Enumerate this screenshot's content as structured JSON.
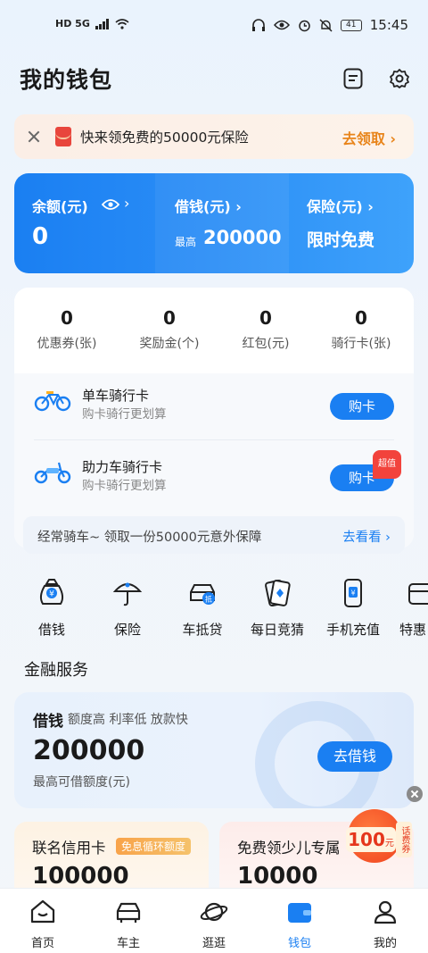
{
  "status_bar": {
    "left_indicators": "HD 5G",
    "battery": "41",
    "time": "15:45"
  },
  "header": {
    "title": "我的钱包",
    "icons": [
      "bill-icon",
      "gear-icon"
    ]
  },
  "promo": {
    "text": "快来领免费的50000元保险",
    "link": "去领取 ›"
  },
  "balance_card": {
    "balance_label": "余额(元)",
    "balance_value": "0",
    "borrow_label": "借钱(元) ›",
    "borrow_prefix": "最高",
    "borrow_value": "200000",
    "insurance_label": "保险(元) ›",
    "insurance_value": "限时免费",
    "accent": "#1a7ff2"
  },
  "stats": [
    {
      "value": "0",
      "label": "优惠券(张)"
    },
    {
      "value": "0",
      "label": "奖励金(个)"
    },
    {
      "value": "0",
      "label": "红包(元)"
    },
    {
      "value": "0",
      "label": "骑行卡(张)"
    }
  ],
  "ride_cards": [
    {
      "title": "单车骑行卡",
      "subtitle": "购卡骑行更划算",
      "button": "购卡",
      "icon": "bicycle-icon"
    },
    {
      "title": "助力车骑行卡",
      "subtitle": "购卡骑行更划算",
      "button": "购卡",
      "badge": "超值",
      "icon": "ebike-icon"
    }
  ],
  "ride_tip": {
    "text": "经常骑车~ 领取一份50000元意外保障",
    "link": "去看看 ›"
  },
  "shortcuts": [
    {
      "label": "借钱",
      "icon": "money-bag-icon"
    },
    {
      "label": "保险",
      "icon": "umbrella-icon"
    },
    {
      "label": "车抵贷",
      "icon": "car-loan-icon"
    },
    {
      "label": "每日竞猜",
      "icon": "cards-icon"
    },
    {
      "label": "手机充值",
      "icon": "phone-topup-icon"
    },
    {
      "label": "特惠",
      "icon": "deal-icon"
    }
  ],
  "finance": {
    "section_title": "金融服务",
    "title": "借钱",
    "subtitle": "额度高 利率低 放款快",
    "amount": "200000",
    "note": "最高可借额度(元)",
    "button": "去借钱"
  },
  "mini_cards": [
    {
      "title": "联名信用卡",
      "tag": "免息循环额度",
      "amount": "100000"
    },
    {
      "title": "免费领少儿专属",
      "amount": "10000"
    }
  ],
  "float_coupon": {
    "amount": "100",
    "unit": "元",
    "tag": "话费券"
  },
  "bottom_nav": [
    {
      "label": "首页",
      "icon": "home-icon"
    },
    {
      "label": "车主",
      "icon": "car-icon"
    },
    {
      "label": "逛逛",
      "icon": "planet-icon"
    },
    {
      "label": "钱包",
      "icon": "wallet-icon",
      "active": true
    },
    {
      "label": "我的",
      "icon": "profile-icon"
    }
  ]
}
